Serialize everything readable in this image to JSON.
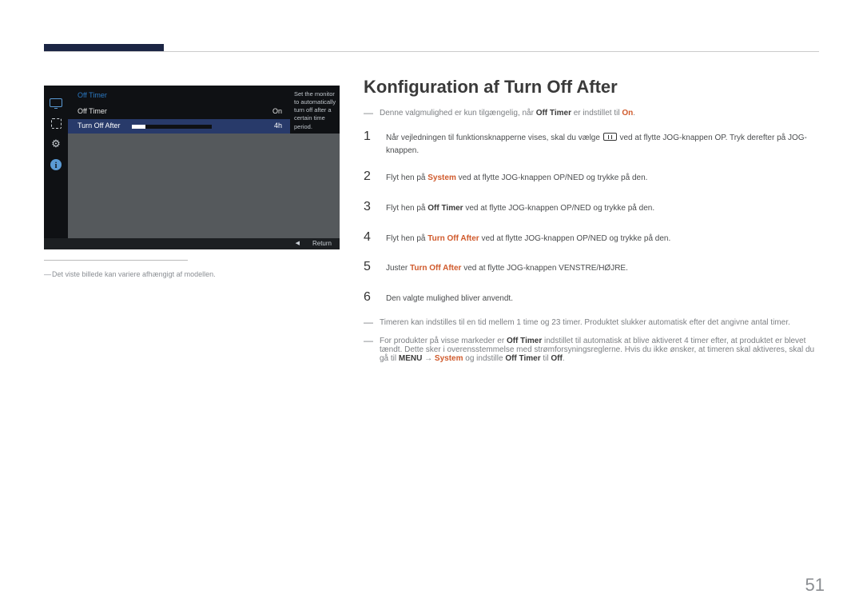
{
  "header": {},
  "osd": {
    "title": "Off Timer",
    "rows": {
      "offTimer": {
        "label": "Off Timer",
        "value": "On"
      },
      "turnOffAfter": {
        "label": "Turn Off After",
        "value": "4h"
      }
    },
    "desc": "Set the monitor to automatically turn off after a certain time period.",
    "footer": {
      "return": "Return"
    }
  },
  "osdCaption": "Det viste billede kan variere afhængigt af modellen.",
  "content": {
    "title": "Konfiguration af Turn Off After",
    "note1_a": "Denne valgmulighed er kun tilgængelig, når ",
    "note1_b": "Off Timer",
    "note1_c": " er indstillet til ",
    "note1_d": "On",
    "note1_e": ".",
    "step1_a": "Når vejledningen til funktionsknapperne vises, skal du vælge ",
    "step1_b": " ved at flytte JOG-knappen OP. Tryk derefter på JOG-knappen.",
    "step2_a": "Flyt hen på ",
    "step2_b": "System",
    "step2_c": " ved at flytte JOG-knappen OP/NED og trykke på den.",
    "step3_a": "Flyt hen på ",
    "step3_b": "Off Timer",
    "step3_c": " ved at flytte JOG-knappen OP/NED og trykke på den.",
    "step4_a": "Flyt hen på ",
    "step4_b": "Turn Off After",
    "step4_c": " ved at flytte JOG-knappen OP/NED og trykke på den.",
    "step5_a": "Juster ",
    "step5_b": "Turn Off After",
    "step5_c": " ved at flytte JOG-knappen VENSTRE/HØJRE.",
    "step6": "Den valgte mulighed bliver anvendt.",
    "note2": "Timeren kan indstilles til en tid mellem 1 time og 23 timer. Produktet slukker automatisk efter det angivne antal timer.",
    "note3_a": "For produkter på visse markeder er ",
    "note3_b": "Off Timer",
    "note3_c": " indstillet til automatisk at blive aktiveret 4 timer efter, at produktet er blevet tændt. Dette sker i overensstemmelse med strømforsyningsreglerne. Hvis du ikke ønsker, at timeren skal aktiveres, skal du gå til ",
    "note3_d": "MENU",
    "note3_arrow": " → ",
    "note3_e": "System",
    "note3_f": " og indstille ",
    "note3_g": "Off Timer",
    "note3_h": " til ",
    "note3_i": "Off",
    "note3_j": "."
  },
  "nums": {
    "n1": "1",
    "n2": "2",
    "n3": "3",
    "n4": "4",
    "n5": "5",
    "n6": "6"
  },
  "pageNumber": "51"
}
